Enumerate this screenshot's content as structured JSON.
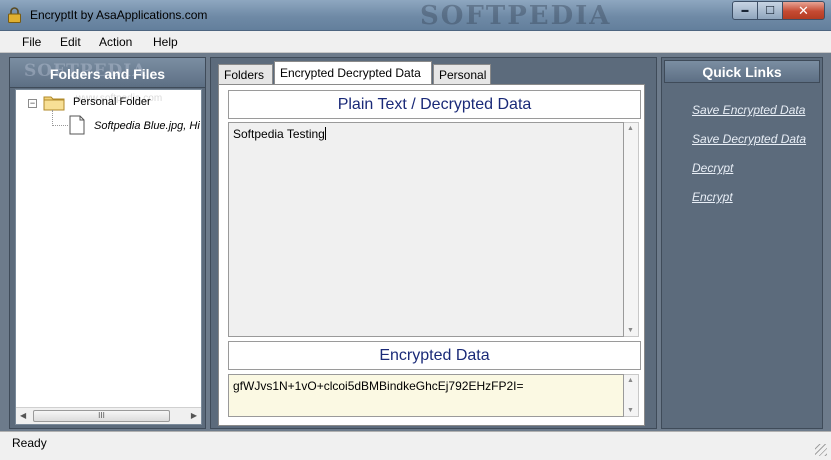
{
  "window": {
    "title": "EncryptIt by AsaApplications.com",
    "watermark": "SOFTPEDIA",
    "minimize_glyph": "▬",
    "maximize_glyph": "☐",
    "close_glyph": "✕"
  },
  "menu": [
    "File",
    "Edit",
    "Action",
    "Help"
  ],
  "left_panel": {
    "header": "Folders and Files",
    "header_watermark": "SOFTPEDIA",
    "tree": {
      "expander": "−",
      "root_label": "Personal Folder",
      "root_watermark": "www.softpedia.com",
      "child_label": "Softpedia Blue.jpg, Hi"
    },
    "scroll_thumb": "III",
    "scroll_left": "◀",
    "scroll_right": "▶"
  },
  "tabs": [
    "Folders",
    "Encrypted Decrypted Data",
    "Personal"
  ],
  "active_tab": 1,
  "plain_section": {
    "header": "Plain Text / Decrypted Data",
    "text": "Softpedia Testing"
  },
  "encrypted_section": {
    "header": "Encrypted Data",
    "text": "gfWJvs1N+1vO+clcoi5dBMBindkeGhcEj792EHzFP2I="
  },
  "scroll_up": "▲",
  "scroll_down": "▼",
  "quick_links": {
    "header": "Quick Links",
    "items": [
      "Save Encrypted Data",
      "Save Decrypted Data",
      "Decrypt",
      "Encrypt"
    ]
  },
  "status": {
    "text": "Ready"
  },
  "colors": {
    "header_text": "#1a2a78",
    "panel_bg": "#5c6b7c",
    "encrypted_box_bg": "#fbf9e3"
  }
}
